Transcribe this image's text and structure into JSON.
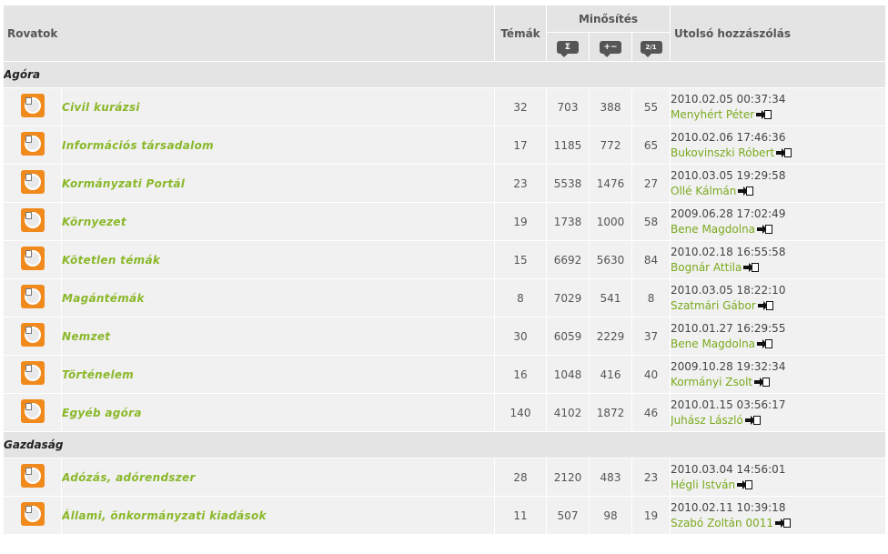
{
  "header": {
    "rovatok": "Rovatok",
    "temak": "Témák",
    "minosites": "Minősítés",
    "utolso": "Utolsó hozzászólás",
    "sub_icons": [
      {
        "glyph": "Σ",
        "name": "sum-icon"
      },
      {
        "glyph": "+−",
        "name": "plus-minus-icon"
      },
      {
        "glyph": "2/1",
        "name": "ratio-icon"
      }
    ]
  },
  "sections": [
    {
      "title": "Agóra",
      "rows": [
        {
          "name": "Civil kurázsi",
          "temak": "32",
          "sum": "703",
          "pm": "388",
          "ratio": "55",
          "date": "2010.02.05 00:37:34",
          "user": "Menyhért Péter"
        },
        {
          "name": "Információs társadalom",
          "temak": "17",
          "sum": "1185",
          "pm": "772",
          "ratio": "65",
          "date": "2010.02.06 17:46:36",
          "user": "Bukovinszki Róbert"
        },
        {
          "name": "Kormányzati Portál",
          "temak": "23",
          "sum": "5538",
          "pm": "1476",
          "ratio": "27",
          "date": "2010.03.05 19:29:58",
          "user": "Ollé Kálmán"
        },
        {
          "name": "Környezet",
          "temak": "19",
          "sum": "1738",
          "pm": "1000",
          "ratio": "58",
          "date": "2009.06.28 17:02:49",
          "user": "Bene Magdolna"
        },
        {
          "name": "Kötetlen témák",
          "temak": "15",
          "sum": "6692",
          "pm": "5630",
          "ratio": "84",
          "date": "2010.02.18 16:55:58",
          "user": "Bognár Attila"
        },
        {
          "name": "Magántémák",
          "temak": "8",
          "sum": "7029",
          "pm": "541",
          "ratio": "8",
          "date": "2010.03.05 18:22:10",
          "user": "Szatmári Gábor"
        },
        {
          "name": "Nemzet",
          "temak": "30",
          "sum": "6059",
          "pm": "2229",
          "ratio": "37",
          "date": "2010.01.27 16:29:55",
          "user": "Bene Magdolna"
        },
        {
          "name": "Történelem",
          "temak": "16",
          "sum": "1048",
          "pm": "416",
          "ratio": "40",
          "date": "2009.10.28 19:32:34",
          "user": "Kormányi Zsolt"
        },
        {
          "name": "Egyéb agóra",
          "temak": "140",
          "sum": "4102",
          "pm": "1872",
          "ratio": "46",
          "date": "2010.01.15 03:56:17",
          "user": "Juhász László"
        }
      ]
    },
    {
      "title": "Gazdaság",
      "rows": [
        {
          "name": "Adózás, adórendszer",
          "temak": "28",
          "sum": "2120",
          "pm": "483",
          "ratio": "23",
          "date": "2010.03.04 14:56:01",
          "user": "Hégli István"
        },
        {
          "name": "Állami, önkormányzati kiadások",
          "temak": "11",
          "sum": "507",
          "pm": "98",
          "ratio": "19",
          "date": "2010.02.11 10:39:18",
          "user": "Szabó Zoltán 0011"
        }
      ]
    }
  ],
  "colors": {
    "header_bg": "#e4e4e4",
    "row_bg": "#f1f1f1",
    "link_green": "#8ab82a",
    "icon_orange": "#f08a1c"
  }
}
